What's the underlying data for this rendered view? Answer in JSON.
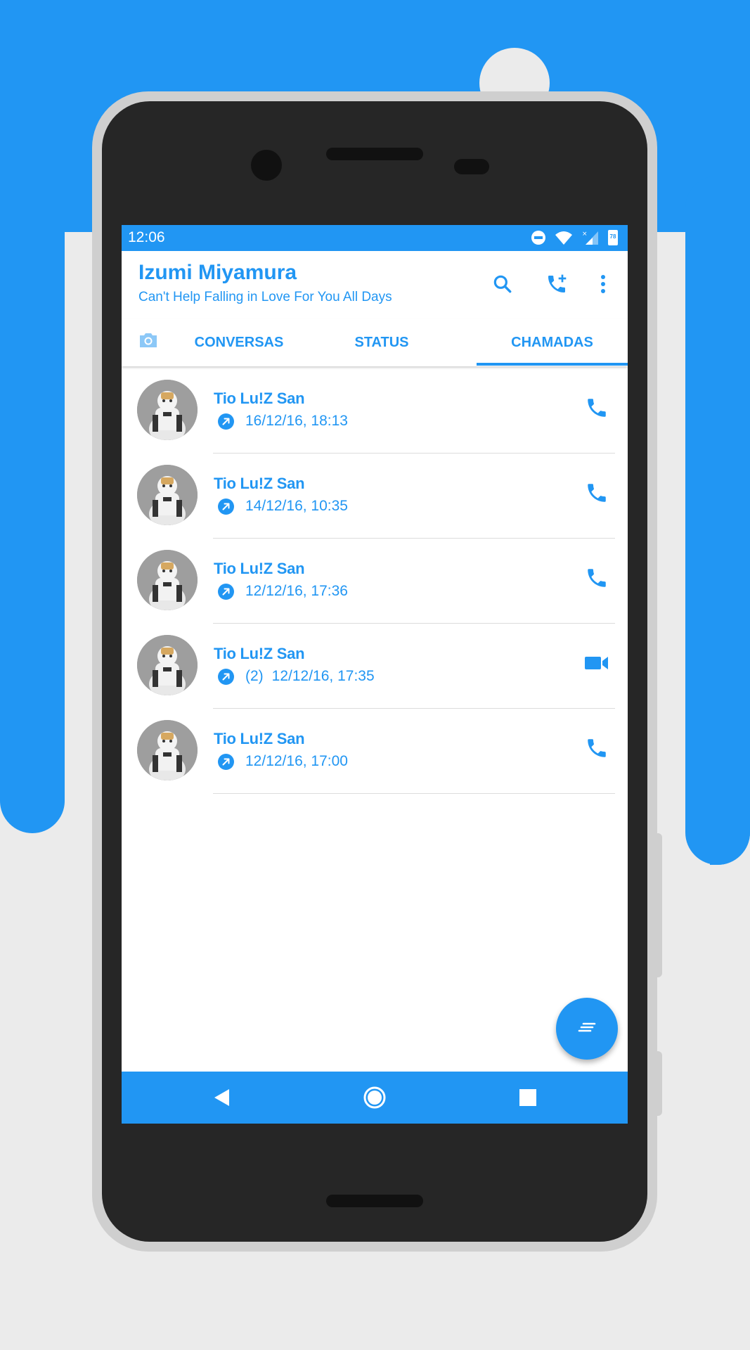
{
  "status_bar": {
    "time": "12:06",
    "battery": "78",
    "icons": [
      "do-not-disturb-icon",
      "wifi-icon",
      "signal-icon",
      "battery-icon"
    ]
  },
  "header": {
    "title": "Izumi Miyamura",
    "subtitle": "Can't Help Falling in Love For You All Days",
    "actions": [
      "search-icon",
      "add-call-icon",
      "more-vert-icon"
    ]
  },
  "tabs": [
    {
      "label": "CONVERSAS",
      "active": false
    },
    {
      "label": "STATUS",
      "active": false
    },
    {
      "label": "CHAMADAS",
      "active": true
    }
  ],
  "calls": [
    {
      "name": "Tio Lu!Z San",
      "count": "",
      "datetime": "16/12/16, 18:13",
      "type": "voice"
    },
    {
      "name": "Tio Lu!Z San",
      "count": "",
      "datetime": "14/12/16, 10:35",
      "type": "voice"
    },
    {
      "name": "Tio Lu!Z San",
      "count": "",
      "datetime": "12/12/16, 17:36",
      "type": "voice"
    },
    {
      "name": "Tio Lu!Z San",
      "count": "(2)",
      "datetime": "12/12/16, 17:35",
      "type": "video"
    },
    {
      "name": "Tio Lu!Z San",
      "count": "",
      "datetime": "12/12/16, 17:00",
      "type": "voice"
    }
  ],
  "colors": {
    "accent": "#2196f3",
    "background": "#ebebeb",
    "phone_body": "#262626",
    "phone_frame": "#cfcfcf"
  },
  "navigation": [
    "back-icon",
    "home-icon",
    "recents-icon"
  ]
}
